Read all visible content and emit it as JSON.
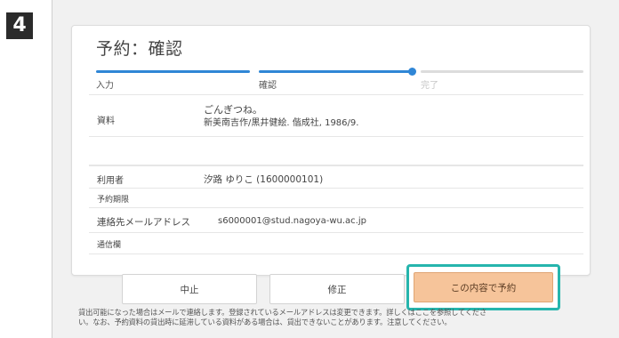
{
  "step_number": "4",
  "title": "予約：確認",
  "progress": {
    "steps": [
      "入力",
      "確認",
      "完了"
    ],
    "current_step": 2
  },
  "details": {
    "material_label": "資料",
    "material_title": "ごんぎつね。",
    "material_info": "新美南吉作/黒井健絵. 偕成社, 1986/9.",
    "user_label": "利用者",
    "user_value": "汐路 ゆりこ (1600000101)",
    "period_label": "予約期限",
    "email_label": "連絡先メールアドレス",
    "email_value": "s6000001@stud.nagoya-wu.ac.jp",
    "memo_label": "通信欄"
  },
  "buttons": {
    "cancel": "中止",
    "edit": "修正",
    "confirm": "この内容で予約"
  },
  "notice": {
    "line1": "貸出可能になった場合はメールで連絡します。登録されているメールアドレスは変更できます。詳しくはここを参照してくださ",
    "line2": "い。なお、予約資料の貸出時に延滞している資料がある場合は、貸出できないことがあります。注意してください。"
  },
  "colors": {
    "progress_active": "#2f86d6",
    "progress_inactive": "#dcdcdc",
    "confirm_button": "#f6c49a",
    "highlight_border": "#26b5ad"
  }
}
